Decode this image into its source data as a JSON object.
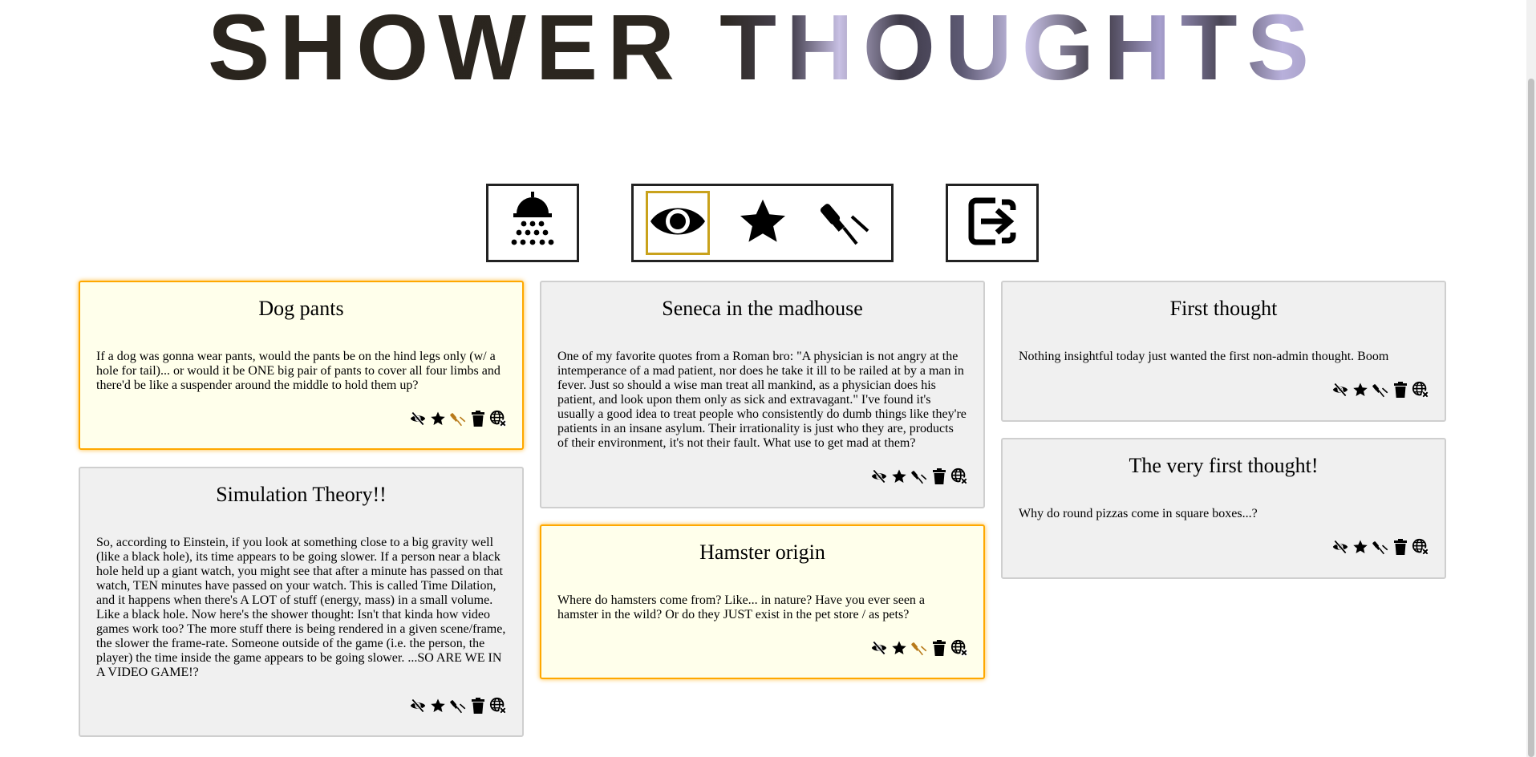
{
  "banner": {
    "title": "SHOWER THOUGHTS"
  },
  "toolbar": {
    "new_thought": {
      "icon": "shower-icon"
    },
    "filters": [
      {
        "icon": "eye-icon",
        "active": true
      },
      {
        "icon": "star-icon",
        "active": false
      },
      {
        "icon": "pin-icon",
        "active": false
      }
    ],
    "logout": {
      "icon": "logout-icon"
    },
    "active_color": "#c9a21c"
  },
  "colors": {
    "card_bg": "#f0f0f0",
    "highlight_bg": "#ffffeb",
    "highlight_border": "#ffa800",
    "pinned_icon": "#b87a1a"
  },
  "thoughts": [
    {
      "title": "Dog pants",
      "body": "If a dog was gonna wear pants, would the pants be on the hind legs only (w/ a hole for tail)... or would it be ONE big pair of pants to cover all four limbs and there'd be like a suspender around the middle to hold them up?",
      "highlighted": true,
      "pinned": true
    },
    {
      "title": "Simulation Theory!!",
      "body": "So, according to Einstein, if you look at something close to a big gravity well (like a black hole), its time appears to be going slower. If a person near a black hole held up a giant watch, you might see that after a minute has passed on that watch, TEN minutes have passed on your watch. This is called Time Dilation, and it happens when there's A LOT of stuff (energy, mass) in a small volume. Like a black hole. Now here's the shower thought: Isn't that kinda how video games work too? The more stuff there is being rendered in a given scene/frame, the slower the frame-rate. Someone outside of the game (i.e. the person, the player) the time inside the game appears to be going slower. ...SO ARE WE IN A VIDEO GAME!?",
      "highlighted": false,
      "pinned": false
    },
    {
      "title": "Seneca in the madhouse",
      "body": "One of my favorite quotes from a Roman bro: \"A physician is not angry at the intemperance of a mad patient, nor does he take it ill to be railed at by a man in fever. Just so should a wise man treat all mankind, as a physician does his patient, and look upon them only as sick and extravagant.\" I've found it's usually a good idea to treat people who consistently do dumb things like they're patients in an insane asylum. Their irrationality is just who they are, products of their environment, it's not their fault. What use to get mad at them?",
      "highlighted": false,
      "pinned": false
    },
    {
      "title": "Hamster origin",
      "body": "Where do hamsters come from? Like... in nature? Have you ever seen a hamster in the wild? Or do they JUST exist in the pet store / as pets?",
      "highlighted": true,
      "pinned": true
    },
    {
      "title": "First thought",
      "body": "Nothing insightful today just wanted the first non-admin thought. Boom",
      "highlighted": false,
      "pinned": false
    },
    {
      "title": "The very first thought!",
      "body": "Why do round pizzas come in square boxes...?",
      "highlighted": false,
      "pinned": false
    }
  ],
  "card_actions": [
    "hide-icon",
    "star-icon",
    "pin-icon",
    "trash-icon",
    "unpublish-globe-icon"
  ]
}
